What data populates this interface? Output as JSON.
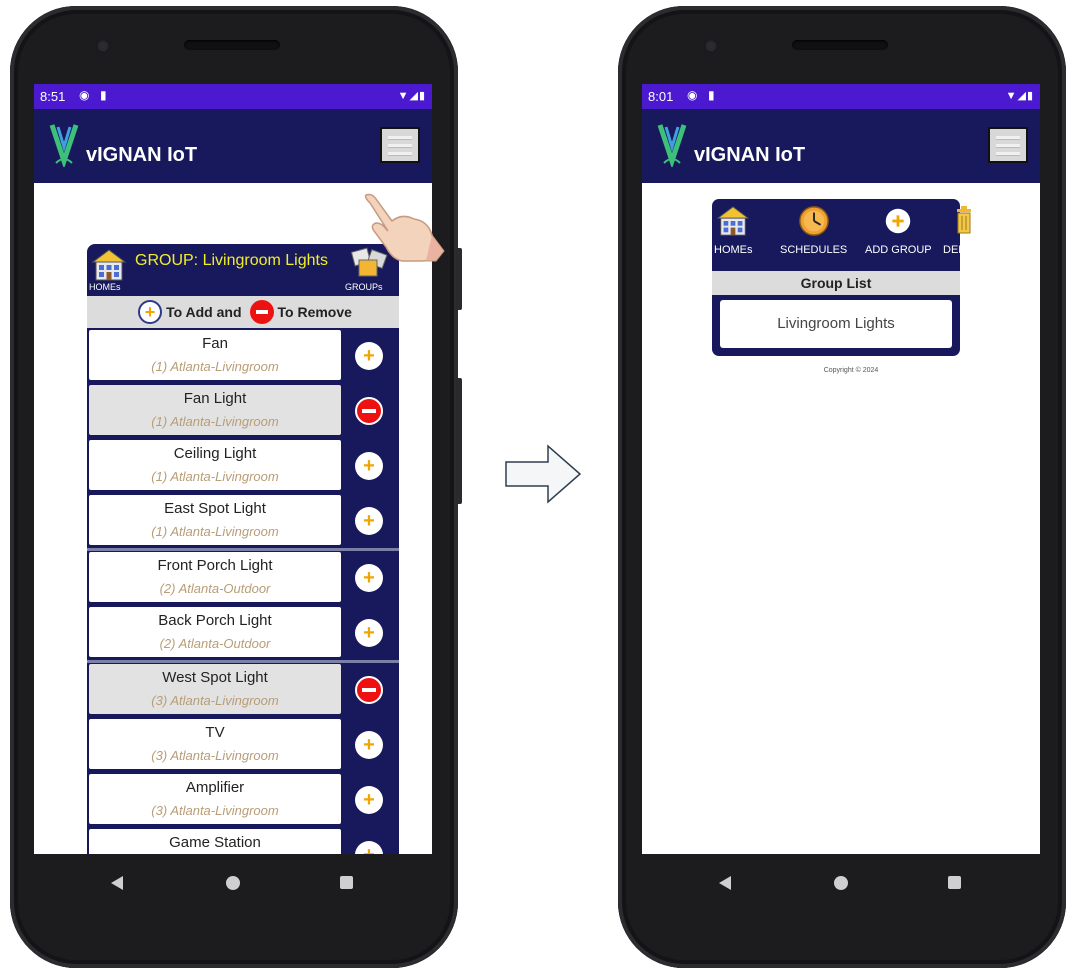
{
  "left_phone": {
    "status_time": "8:51",
    "app_title": "vIGNAN IoT",
    "group_title": "GROUP: Livingroom Lights",
    "homes_label": "HOMEs",
    "groups_label": "GROUPs",
    "add_text": "To Add and",
    "remove_text": "To Remove",
    "devices": [
      {
        "name": "Fan",
        "location": "(1) Atlanta-Livingroom",
        "selected": false
      },
      {
        "name": "Fan Light",
        "location": "(1) Atlanta-Livingroom",
        "selected": true
      },
      {
        "name": "Ceiling Light",
        "location": "(1) Atlanta-Livingroom",
        "selected": false
      },
      {
        "name": "East Spot Light",
        "location": "(1) Atlanta-Livingroom",
        "selected": false
      },
      {
        "name": "Front Porch Light",
        "location": "(2) Atlanta-Outdoor",
        "selected": false
      },
      {
        "name": "Back Porch Light",
        "location": "(2) Atlanta-Outdoor",
        "selected": false
      },
      {
        "name": "West Spot Light",
        "location": "(3) Atlanta-Livingroom",
        "selected": true
      },
      {
        "name": "TV",
        "location": "(3) Atlanta-Livingroom",
        "selected": false
      },
      {
        "name": "Amplifier",
        "location": "(3) Atlanta-Livingroom",
        "selected": false
      },
      {
        "name": "Game Station",
        "location": "",
        "selected": false
      }
    ]
  },
  "right_phone": {
    "status_time": "8:01",
    "app_title": "vIGNAN IoT",
    "toolbar": {
      "homes": "HOMEs",
      "schedules": "SCHEDULES",
      "add_group": "ADD GROUP",
      "delete": "DELETE"
    },
    "group_list_title": "Group List",
    "groups": [
      "Livingroom Lights"
    ],
    "copyright": "Copyright © 2024"
  },
  "colors": {
    "status_bar": "#4b1ad0",
    "app_bar": "#17195c",
    "group_title": "#f3ee2a",
    "add_accent": "#f2a500",
    "remove_red": "#e11111"
  }
}
